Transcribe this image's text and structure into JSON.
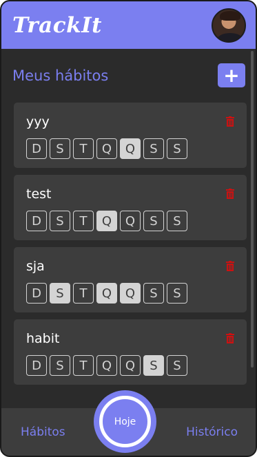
{
  "app": {
    "logo": "TrackIt",
    "avatar_icon": "user-avatar"
  },
  "page": {
    "title": "Meus hábitos",
    "add_label": "+"
  },
  "habits": [
    {
      "name": "yyy",
      "days": [
        {
          "label": "D",
          "selected": false
        },
        {
          "label": "S",
          "selected": false
        },
        {
          "label": "T",
          "selected": false
        },
        {
          "label": "Q",
          "selected": false
        },
        {
          "label": "Q",
          "selected": true
        },
        {
          "label": "S",
          "selected": false
        },
        {
          "label": "S",
          "selected": false
        }
      ]
    },
    {
      "name": "test",
      "days": [
        {
          "label": "D",
          "selected": false
        },
        {
          "label": "S",
          "selected": false
        },
        {
          "label": "T",
          "selected": false
        },
        {
          "label": "Q",
          "selected": true
        },
        {
          "label": "Q",
          "selected": false
        },
        {
          "label": "S",
          "selected": false
        },
        {
          "label": "S",
          "selected": false
        }
      ]
    },
    {
      "name": "sja",
      "days": [
        {
          "label": "D",
          "selected": false
        },
        {
          "label": "S",
          "selected": true
        },
        {
          "label": "T",
          "selected": false
        },
        {
          "label": "Q",
          "selected": true
        },
        {
          "label": "Q",
          "selected": true
        },
        {
          "label": "S",
          "selected": false
        },
        {
          "label": "S",
          "selected": false
        }
      ]
    },
    {
      "name": "habit",
      "days": [
        {
          "label": "D",
          "selected": false
        },
        {
          "label": "S",
          "selected": false
        },
        {
          "label": "T",
          "selected": false
        },
        {
          "label": "Q",
          "selected": false
        },
        {
          "label": "Q",
          "selected": false
        },
        {
          "label": "S",
          "selected": true
        },
        {
          "label": "S",
          "selected": false
        }
      ]
    }
  ],
  "nav": {
    "habits_label": "Hábitos",
    "today_label": "Hoje",
    "history_label": "Histórico"
  },
  "colors": {
    "accent": "#7b7ff0",
    "background": "#2b2b2b",
    "card": "#3d3d3d",
    "delete": "#cc1111"
  }
}
